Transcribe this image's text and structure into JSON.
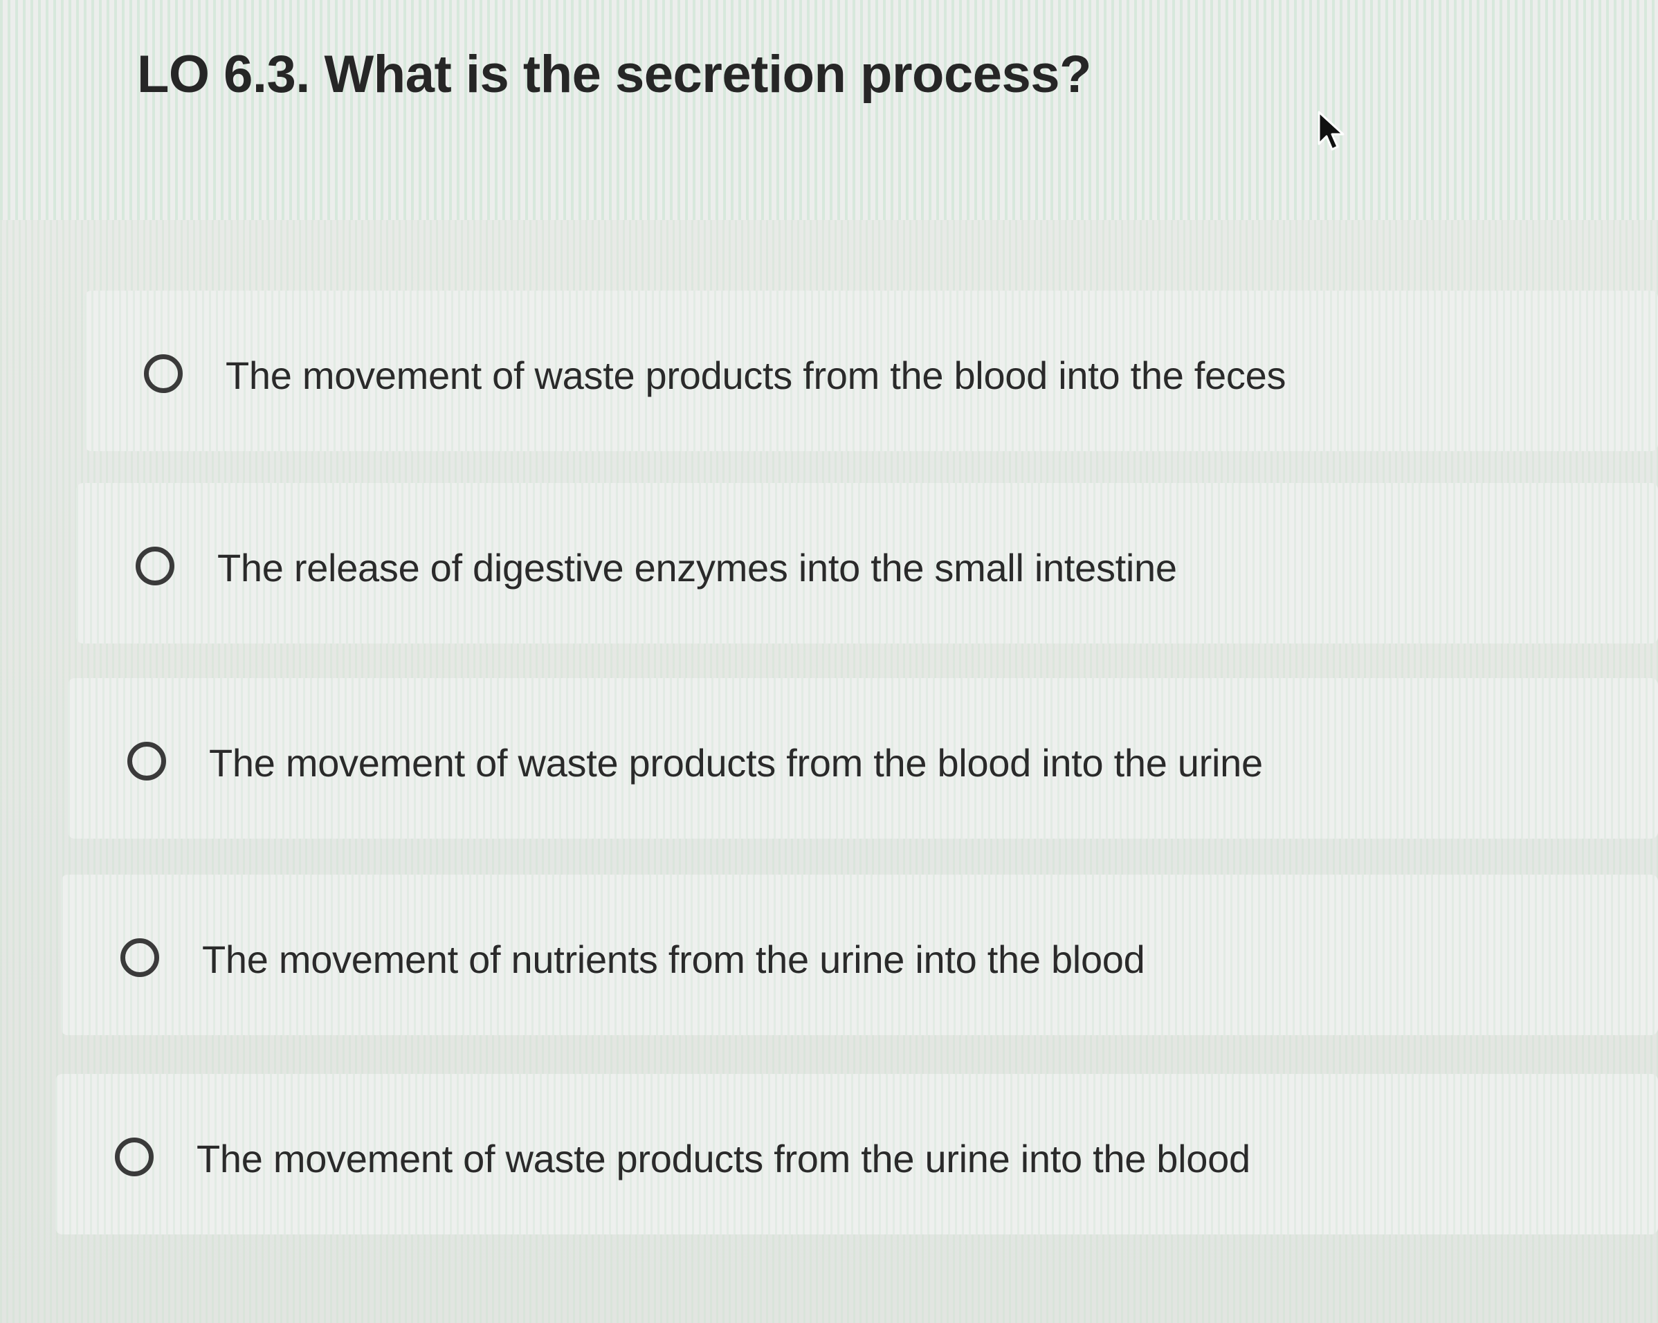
{
  "question": {
    "title": "LO 6.3. What is the secretion process?"
  },
  "answers": [
    {
      "label": "The movement of waste products from the blood into the feces"
    },
    {
      "label": "The release of digestive enzymes into the small intestine"
    },
    {
      "label": "The movement of waste products from the blood into the urine"
    },
    {
      "label": "The movement of nutrients from the urine into the blood"
    },
    {
      "label": "The movement of waste products from the urine into the blood"
    }
  ],
  "icons": {
    "cursor": "mouse-pointer-icon",
    "radio": "radio-unselected-icon"
  },
  "colors": {
    "text": "#2a2a2a",
    "radio_border": "#3a3a3a",
    "background": "#e6e8e5"
  }
}
